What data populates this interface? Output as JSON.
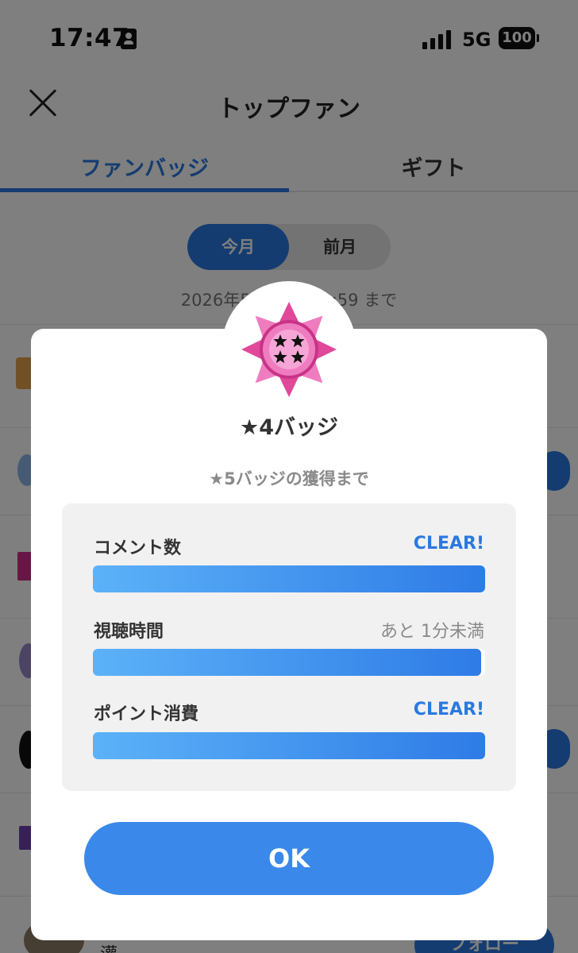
{
  "status_bar": {
    "time": "17:47",
    "network": "5G",
    "battery": "100"
  },
  "header": {
    "title": "トップファン"
  },
  "tabs": [
    {
      "label": "ファンバッジ"
    },
    {
      "label": "ギフト"
    }
  ],
  "period_toggle": {
    "options": [
      "今月",
      "前月"
    ],
    "selected": "今月"
  },
  "period_text": "2026年5月31日 23:59 まで",
  "background_list": {
    "follow_label": "フォロー",
    "partial_name": "灌..."
  },
  "modal": {
    "badge_title": "★4バッジ",
    "subtitle": "★5バッジの獲得まで",
    "progress": [
      {
        "label": "コメント数",
        "status": "CLEAR!",
        "fill_fraction": 1.0
      },
      {
        "label": "視聴時間",
        "status": "あと 1分未満",
        "fill_fraction": 0.99
      },
      {
        "label": "ポイント消費",
        "status": "CLEAR!",
        "fill_fraction": 1.0
      }
    ],
    "ok_label": "OK"
  },
  "colors": {
    "accent": "#2a79e0",
    "badge_pink": "#e0489a",
    "badge_light_pink": "#f07cc0",
    "progress_start": "#5cb2f8",
    "progress_end": "#2e7be6"
  },
  "icons": {
    "close": "close-icon",
    "badge": "star-badge-icon",
    "id_card": "id-card-icon",
    "signal": "signal-icon",
    "battery": "battery-icon"
  }
}
